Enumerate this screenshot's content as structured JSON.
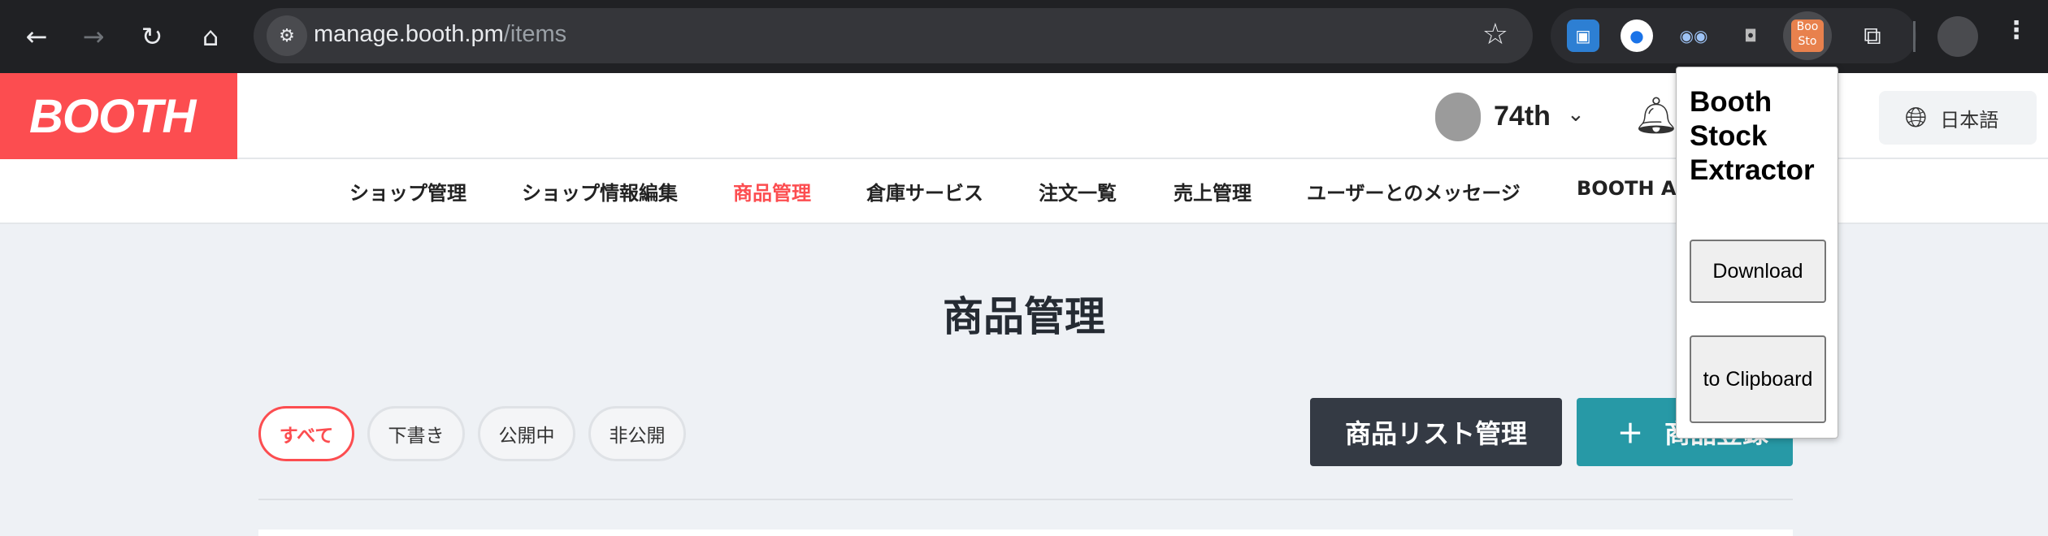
{
  "browser": {
    "url_host": "manage.booth.pm",
    "url_path": "/items",
    "nav_icons": [
      "back-arrow-icon",
      "forward-arrow-icon",
      "reload-icon",
      "home-icon"
    ],
    "extension_tile_text": "Boo Sto"
  },
  "header": {
    "logo_text": "BOOTH",
    "username": "74th",
    "language_label": "日本語"
  },
  "subnav": {
    "items": [
      "ショップ管理",
      "ショップ情報編集",
      "商品管理",
      "倉庫サービス",
      "注文一覧",
      "売上管理",
      "ユーザーとのメッセージ",
      "BOOTH Ap"
    ],
    "active_index": 2
  },
  "main": {
    "page_title": "商品管理",
    "filters": [
      "すべて",
      "下書き",
      "公開中",
      "非公開"
    ],
    "active_filter": 0,
    "list_manage_button": "商品リスト管理",
    "add_item_button": "商品登録"
  },
  "popup": {
    "title": "Booth Stock Extractor",
    "download_button": "Download",
    "clipboard_button": "to Clipboard"
  },
  "colors": {
    "brand_red": "#fc4d50",
    "teal_button": "#2799a6",
    "dark_button": "#343a44",
    "chrome_dark": "#202124"
  }
}
